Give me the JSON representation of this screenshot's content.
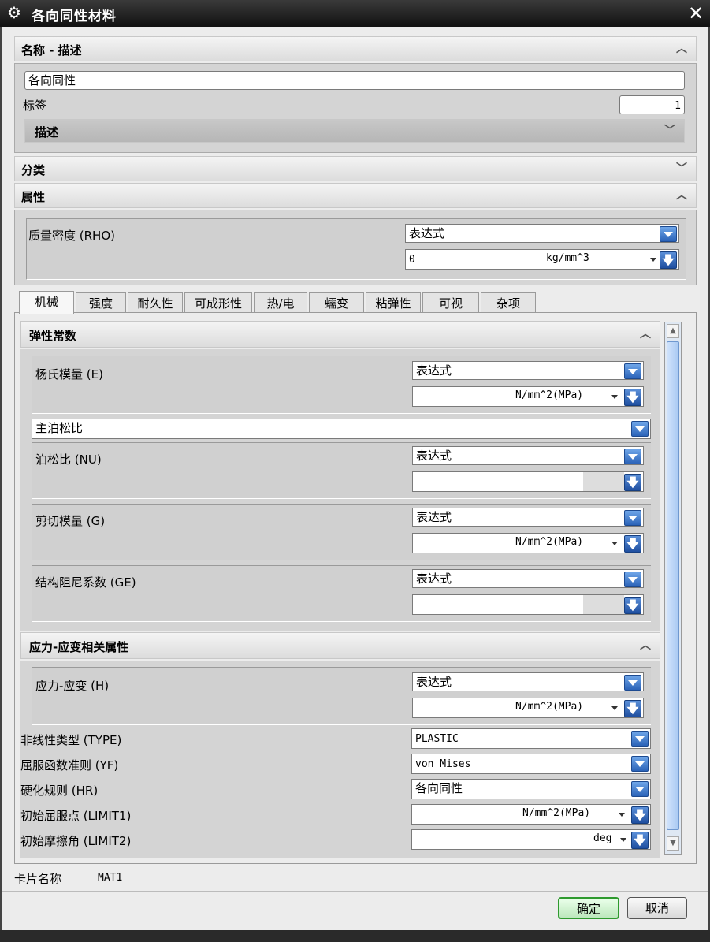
{
  "window": {
    "title": "各向同性材料"
  },
  "name_section": {
    "header": "名称 - 描述",
    "name_value": "各向同性",
    "label_label": "标签",
    "label_value": "1",
    "desc_header": "描述"
  },
  "category_section": {
    "header": "分类"
  },
  "properties_section": {
    "header": "属性",
    "density_label": "质量密度 (RHO)",
    "density_mode": "表达式",
    "density_value": "0",
    "density_unit": "kg/mm^3"
  },
  "tabs": [
    "机械",
    "强度",
    "耐久性",
    "可成形性",
    "热/电",
    "蠕变",
    "粘弹性",
    "可视",
    "杂项"
  ],
  "elastic": {
    "header": "弹性常数",
    "youngs_label": "杨氏模量 (E)",
    "youngs_mode": "表达式",
    "youngs_unit": "N/mm^2(MPa)",
    "poisson_select": "主泊松比",
    "poisson_label": "泊松比 (NU)",
    "poisson_mode": "表达式",
    "shear_label": "剪切模量 (G)",
    "shear_mode": "表达式",
    "shear_unit": "N/mm^2(MPa)",
    "damping_label": "结构阻尼系数 (GE)",
    "damping_mode": "表达式"
  },
  "stress_strain": {
    "header": "应力-应变相关属性",
    "ss_label": "应力-应变 (H)",
    "ss_mode": "表达式",
    "ss_unit": "N/mm^2(MPa)",
    "nl_type_label": "非线性类型 (TYPE)",
    "nl_type_value": "PLASTIC",
    "yield_label": "屈服函数准则 (YF)",
    "yield_value": "von Mises",
    "hardening_label": "硬化规则 (HR)",
    "hardening_value": "各向同性",
    "limit1_label": "初始屈服点 (LIMIT1)",
    "limit1_unit": "N/mm^2(MPa)",
    "limit2_label": "初始摩擦角 (LIMIT2)",
    "limit2_unit": "deg"
  },
  "footer": {
    "card_label": "卡片名称",
    "card_value": "MAT1",
    "ok_label": "确定",
    "cancel_label": "取消"
  },
  "icons": {
    "window": "gear-icon",
    "close": "close-icon",
    "collapse": "chevron-up-icon",
    "expand": "chevron-down-icon",
    "dropdown": "dropdown-arrow-icon",
    "down": "arrow-down-icon"
  }
}
